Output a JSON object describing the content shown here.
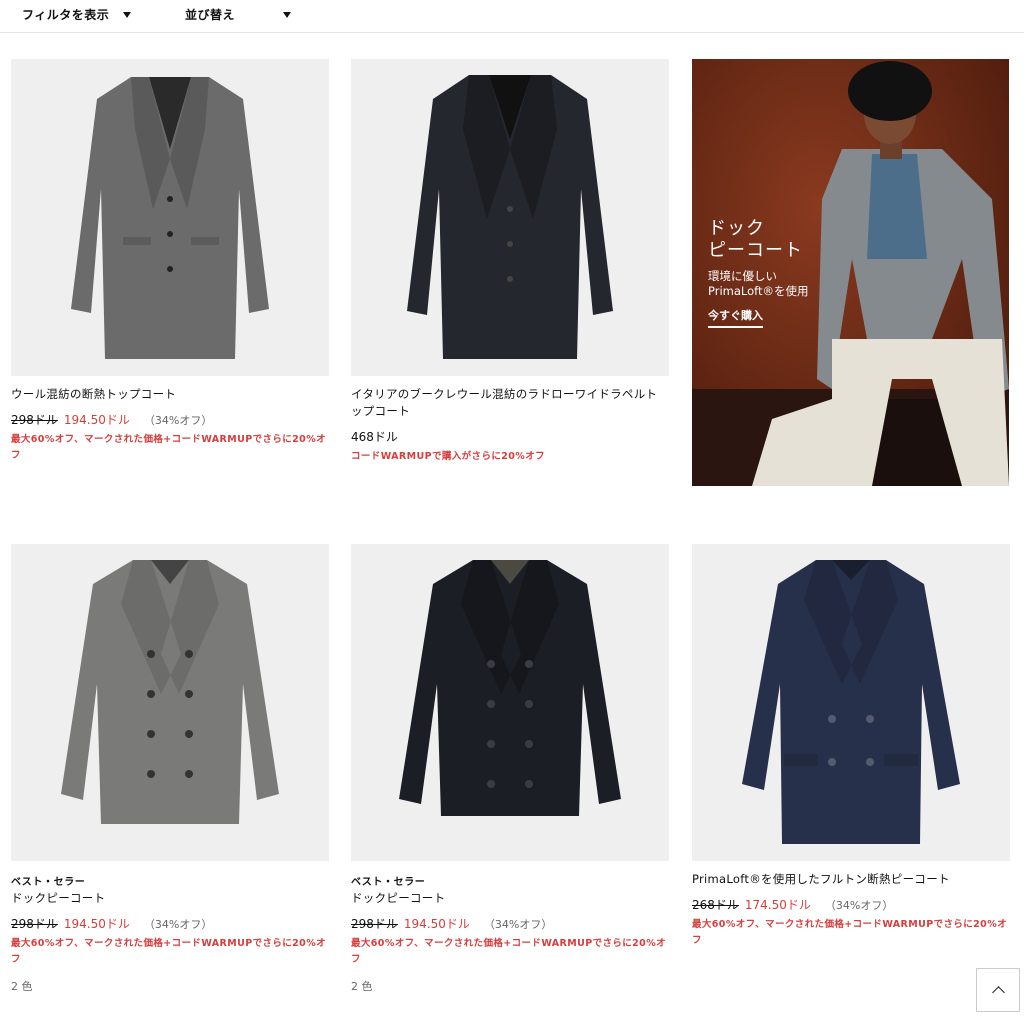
{
  "toolbar": {
    "filter_label": "フィルタを表示",
    "sort_label": "並び替え"
  },
  "products": [
    {
      "name": "ウール混紡の断熱トップコート",
      "was": "298ドル",
      "now": "194.50ドル",
      "pct": "（34%オフ）",
      "promo": "最大60%オフ、マークされた価格+コードWARMUPでさらに20%オフ",
      "coat_color": "#6b6b6b"
    },
    {
      "name": "イタリアのブークレウール混紡のラドローワイドラペルトップコート",
      "price": "468ドル",
      "promo": "コードWARMUPで購入がさらに20%オフ",
      "coat_color": "#24272d"
    },
    {
      "badge": "ベスト・セラー",
      "name": "ドックピーコート",
      "was": "298ドル",
      "now": "194.50ドル",
      "pct": "（34%オフ）",
      "promo": "最大60%オフ、マークされた価格+コードWARMUPでさらに20%オフ",
      "colors": "2 色",
      "coat_color": "#7a7a78"
    },
    {
      "badge": "ベスト・セラー",
      "name": "ドックピーコート",
      "was": "298ドル",
      "now": "194.50ドル",
      "pct": "（34%オフ）",
      "promo": "最大60%オフ、マークされた価格+コードWARMUPでさらに20%オフ",
      "colors": "2 色",
      "coat_color": "#1c1e25"
    },
    {
      "name": "PrimaLoft®を使用したフルトン断熱ピーコート",
      "was": "268ドル",
      "now": "174.50ドル",
      "pct": "（34%オフ）",
      "promo": "最大60%オフ、マークされた価格+コードWARMUPでさらに20%オフ",
      "coat_color": "#27304a"
    }
  ],
  "banner": {
    "title_line1": "ドック",
    "title_line2": "ピーコート",
    "sub_line1": "環境に優しい",
    "sub_line2": "PrimaLoft®を使用",
    "cta": "今すぐ購入",
    "bg_color": "#6e2a16"
  }
}
